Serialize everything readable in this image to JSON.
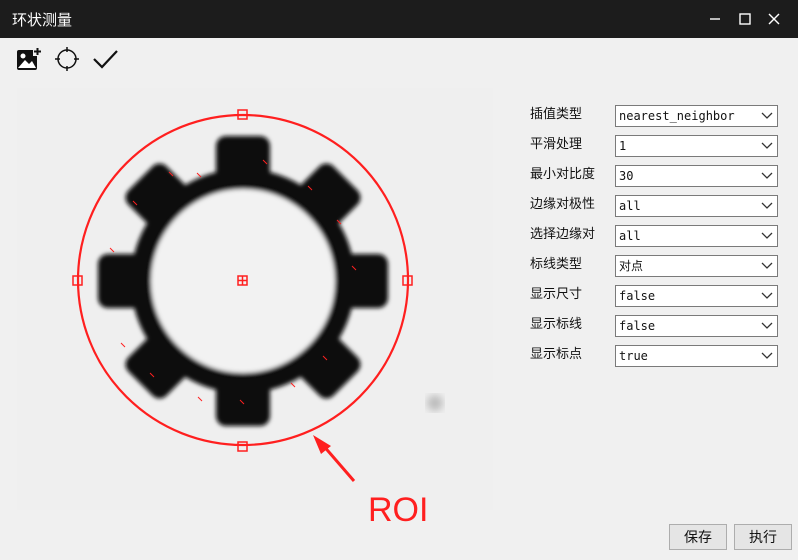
{
  "window": {
    "title": "环状测量"
  },
  "toolbar": {
    "icons": [
      "add-image-icon",
      "circle-target-icon",
      "checkmark-icon"
    ]
  },
  "image": {
    "annotation": "ROI"
  },
  "params": [
    {
      "label": "插值类型",
      "value": "nearest_neighbor"
    },
    {
      "label": "平滑处理",
      "value": "1"
    },
    {
      "label": "最小对比度",
      "value": "30"
    },
    {
      "label": "边缘对极性",
      "value": "all"
    },
    {
      "label": "选择边缘对",
      "value": "all"
    },
    {
      "label": "标线类型",
      "value": "对点"
    },
    {
      "label": "显示尺寸",
      "value": "false"
    },
    {
      "label": "显示标线",
      "value": "false"
    },
    {
      "label": "显示标点",
      "value": "true"
    }
  ],
  "buttons": {
    "save": "保存",
    "execute": "执行"
  },
  "colors": {
    "roi": "#ff1f1f",
    "titlebar": "#1c1c1c",
    "gear": "#0a0a0a"
  }
}
